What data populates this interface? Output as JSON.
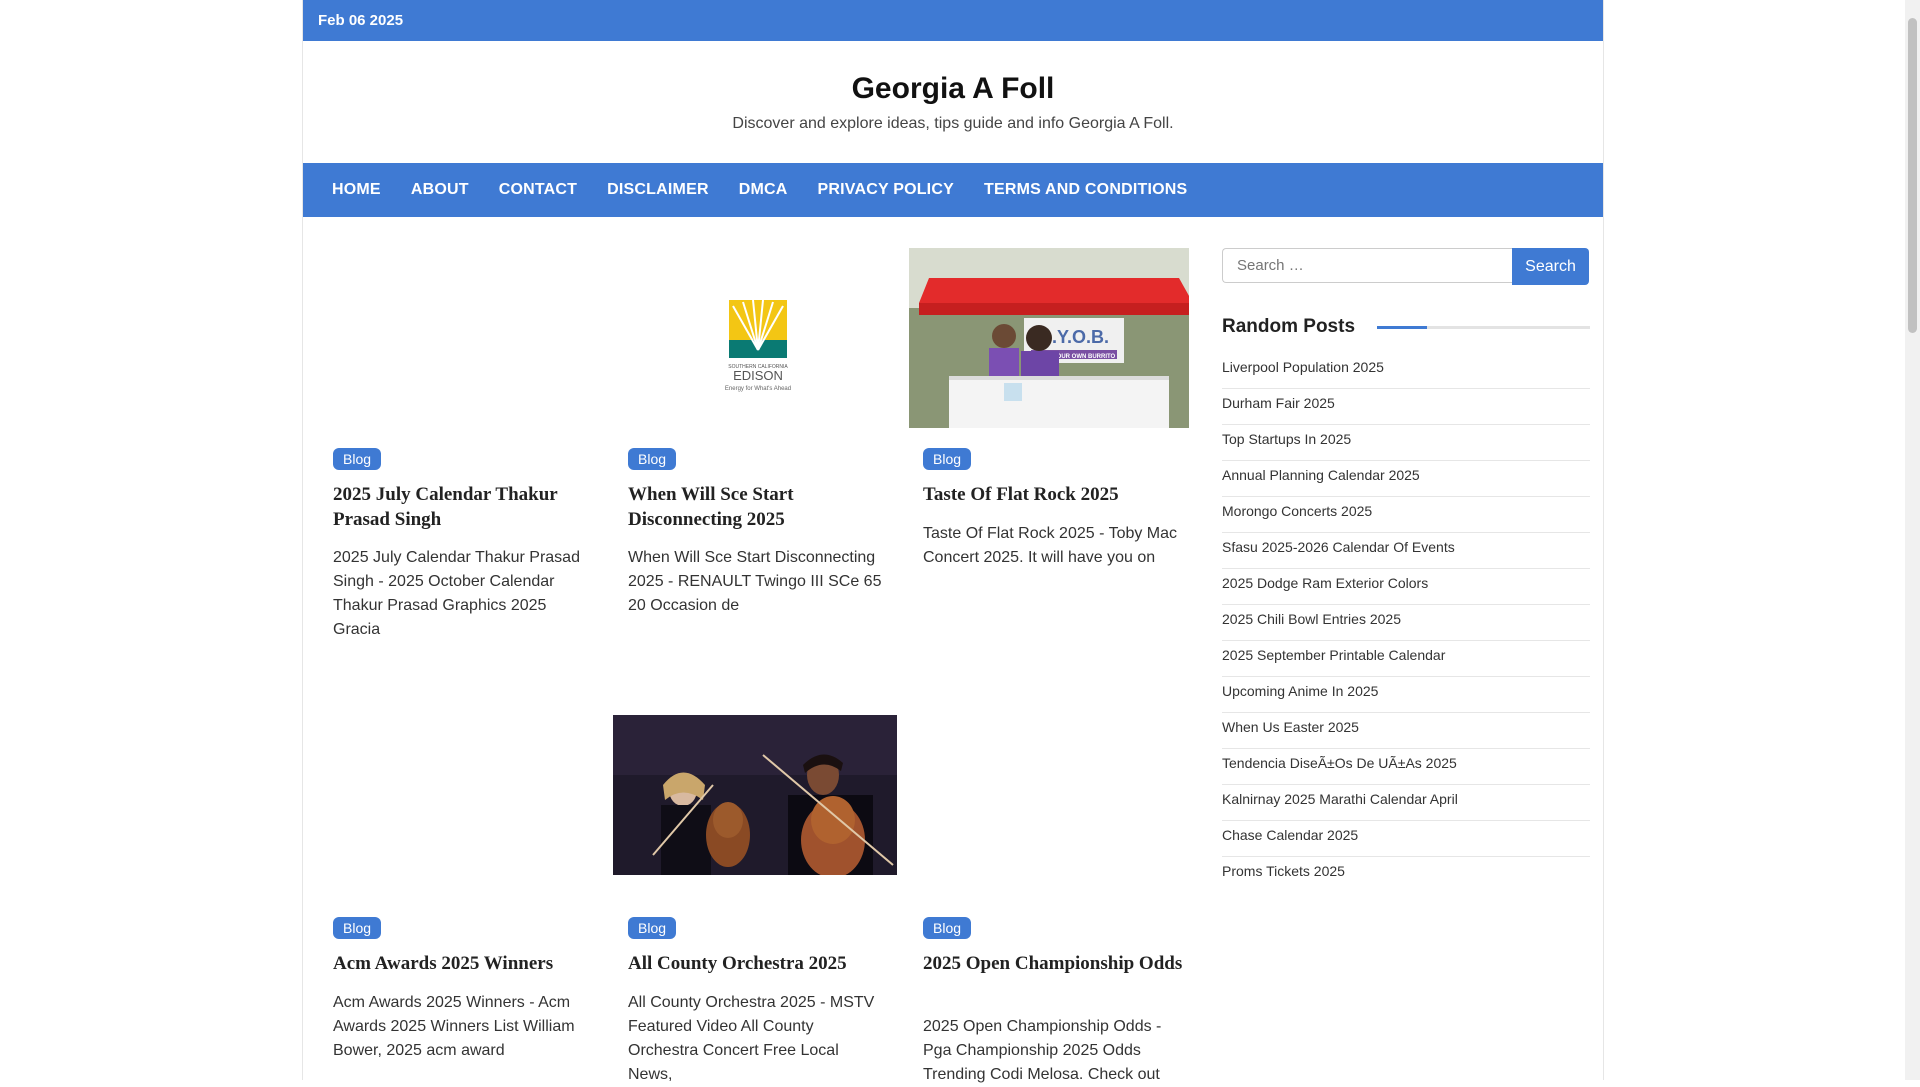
{
  "topbar": {
    "date": "Feb 06 2025"
  },
  "site": {
    "title": "Georgia A Foll",
    "description": "Discover and explore ideas, tips guide and info Georgia A Foll."
  },
  "nav": [
    "HOME",
    "ABOUT",
    "CONTACT",
    "DISCLAIMER",
    "DMCA",
    "PRIVACY POLICY",
    "TERMS AND CONDITIONS"
  ],
  "posts": [
    {
      "category": "Blog",
      "title": "2025 July Calendar Thakur Prasad Singh",
      "excerpt": "2025 July Calendar Thakur Prasad Singh - 2025 October Calendar Thakur Prasad Graphics 2025 Gracia",
      "image": "none"
    },
    {
      "category": "Blog",
      "title": "When Will Sce Start Disconnecting 2025",
      "excerpt": "When Will Sce Start Disconnecting 2025 - RENAULT Twingo III SCe 65 20 Occasion de",
      "image": "edison-logo",
      "logo_small": "SOUTHERN CALIFORNIA",
      "logo_name": "EDISON",
      "logo_tagline": "Energy for What's Ahead"
    },
    {
      "category": "Blog",
      "title": "Taste Of Flat Rock 2025",
      "excerpt": "Taste Of Flat Rock 2025 - Toby Mac Concert 2025. It will have you on",
      "image": "byob-booth-photo",
      "sign_text": "B.Y.O.B.",
      "sign_sub": "BUILD YOUR OWN BURRITO"
    },
    {
      "category": "Blog",
      "title": "Acm Awards 2025 Winners",
      "excerpt": "Acm Awards 2025 Winners - Acm Awards 2025 Winners List William Bower, 2025 acm award",
      "image": "none"
    },
    {
      "category": "Blog",
      "title": "All County Orchestra 2025",
      "excerpt": "All County Orchestra 2025 - MSTV Featured Video All County Orchestra Concert Free Local News,",
      "image": "orchestra-photo"
    },
    {
      "category": "Blog",
      "title": "2025 Open Championship Odds",
      "excerpt": "2025 Open Championship Odds - Pga Championship 2025 Odds Trending Codi Melosa. Check out",
      "image": "none"
    }
  ],
  "sidebar": {
    "search_placeholder": "Search …",
    "search_button": "Search",
    "widget_title": "Random Posts",
    "random_posts": [
      "Liverpool Population 2025",
      "Durham Fair 2025",
      "Top Startups In 2025",
      "Annual Planning Calendar 2025",
      "Morongo Concerts 2025",
      "Sfasu 2025-2026 Calendar Of Events",
      "2025 Dodge Ram Exterior Colors",
      "2025 Chili Bowl Entries 2025",
      "2025 September Printable Calendar",
      "Upcoming Anime In 2025",
      "When Us Easter 2025",
      "Tendencia DiseÃ±Os De UÃ±As 2025",
      "Kalnirnay 2025 Marathi Calendar April",
      "Chase Calendar 2025",
      "Proms Tickets 2025"
    ]
  },
  "colors": {
    "accent": "#3f7ad3"
  }
}
